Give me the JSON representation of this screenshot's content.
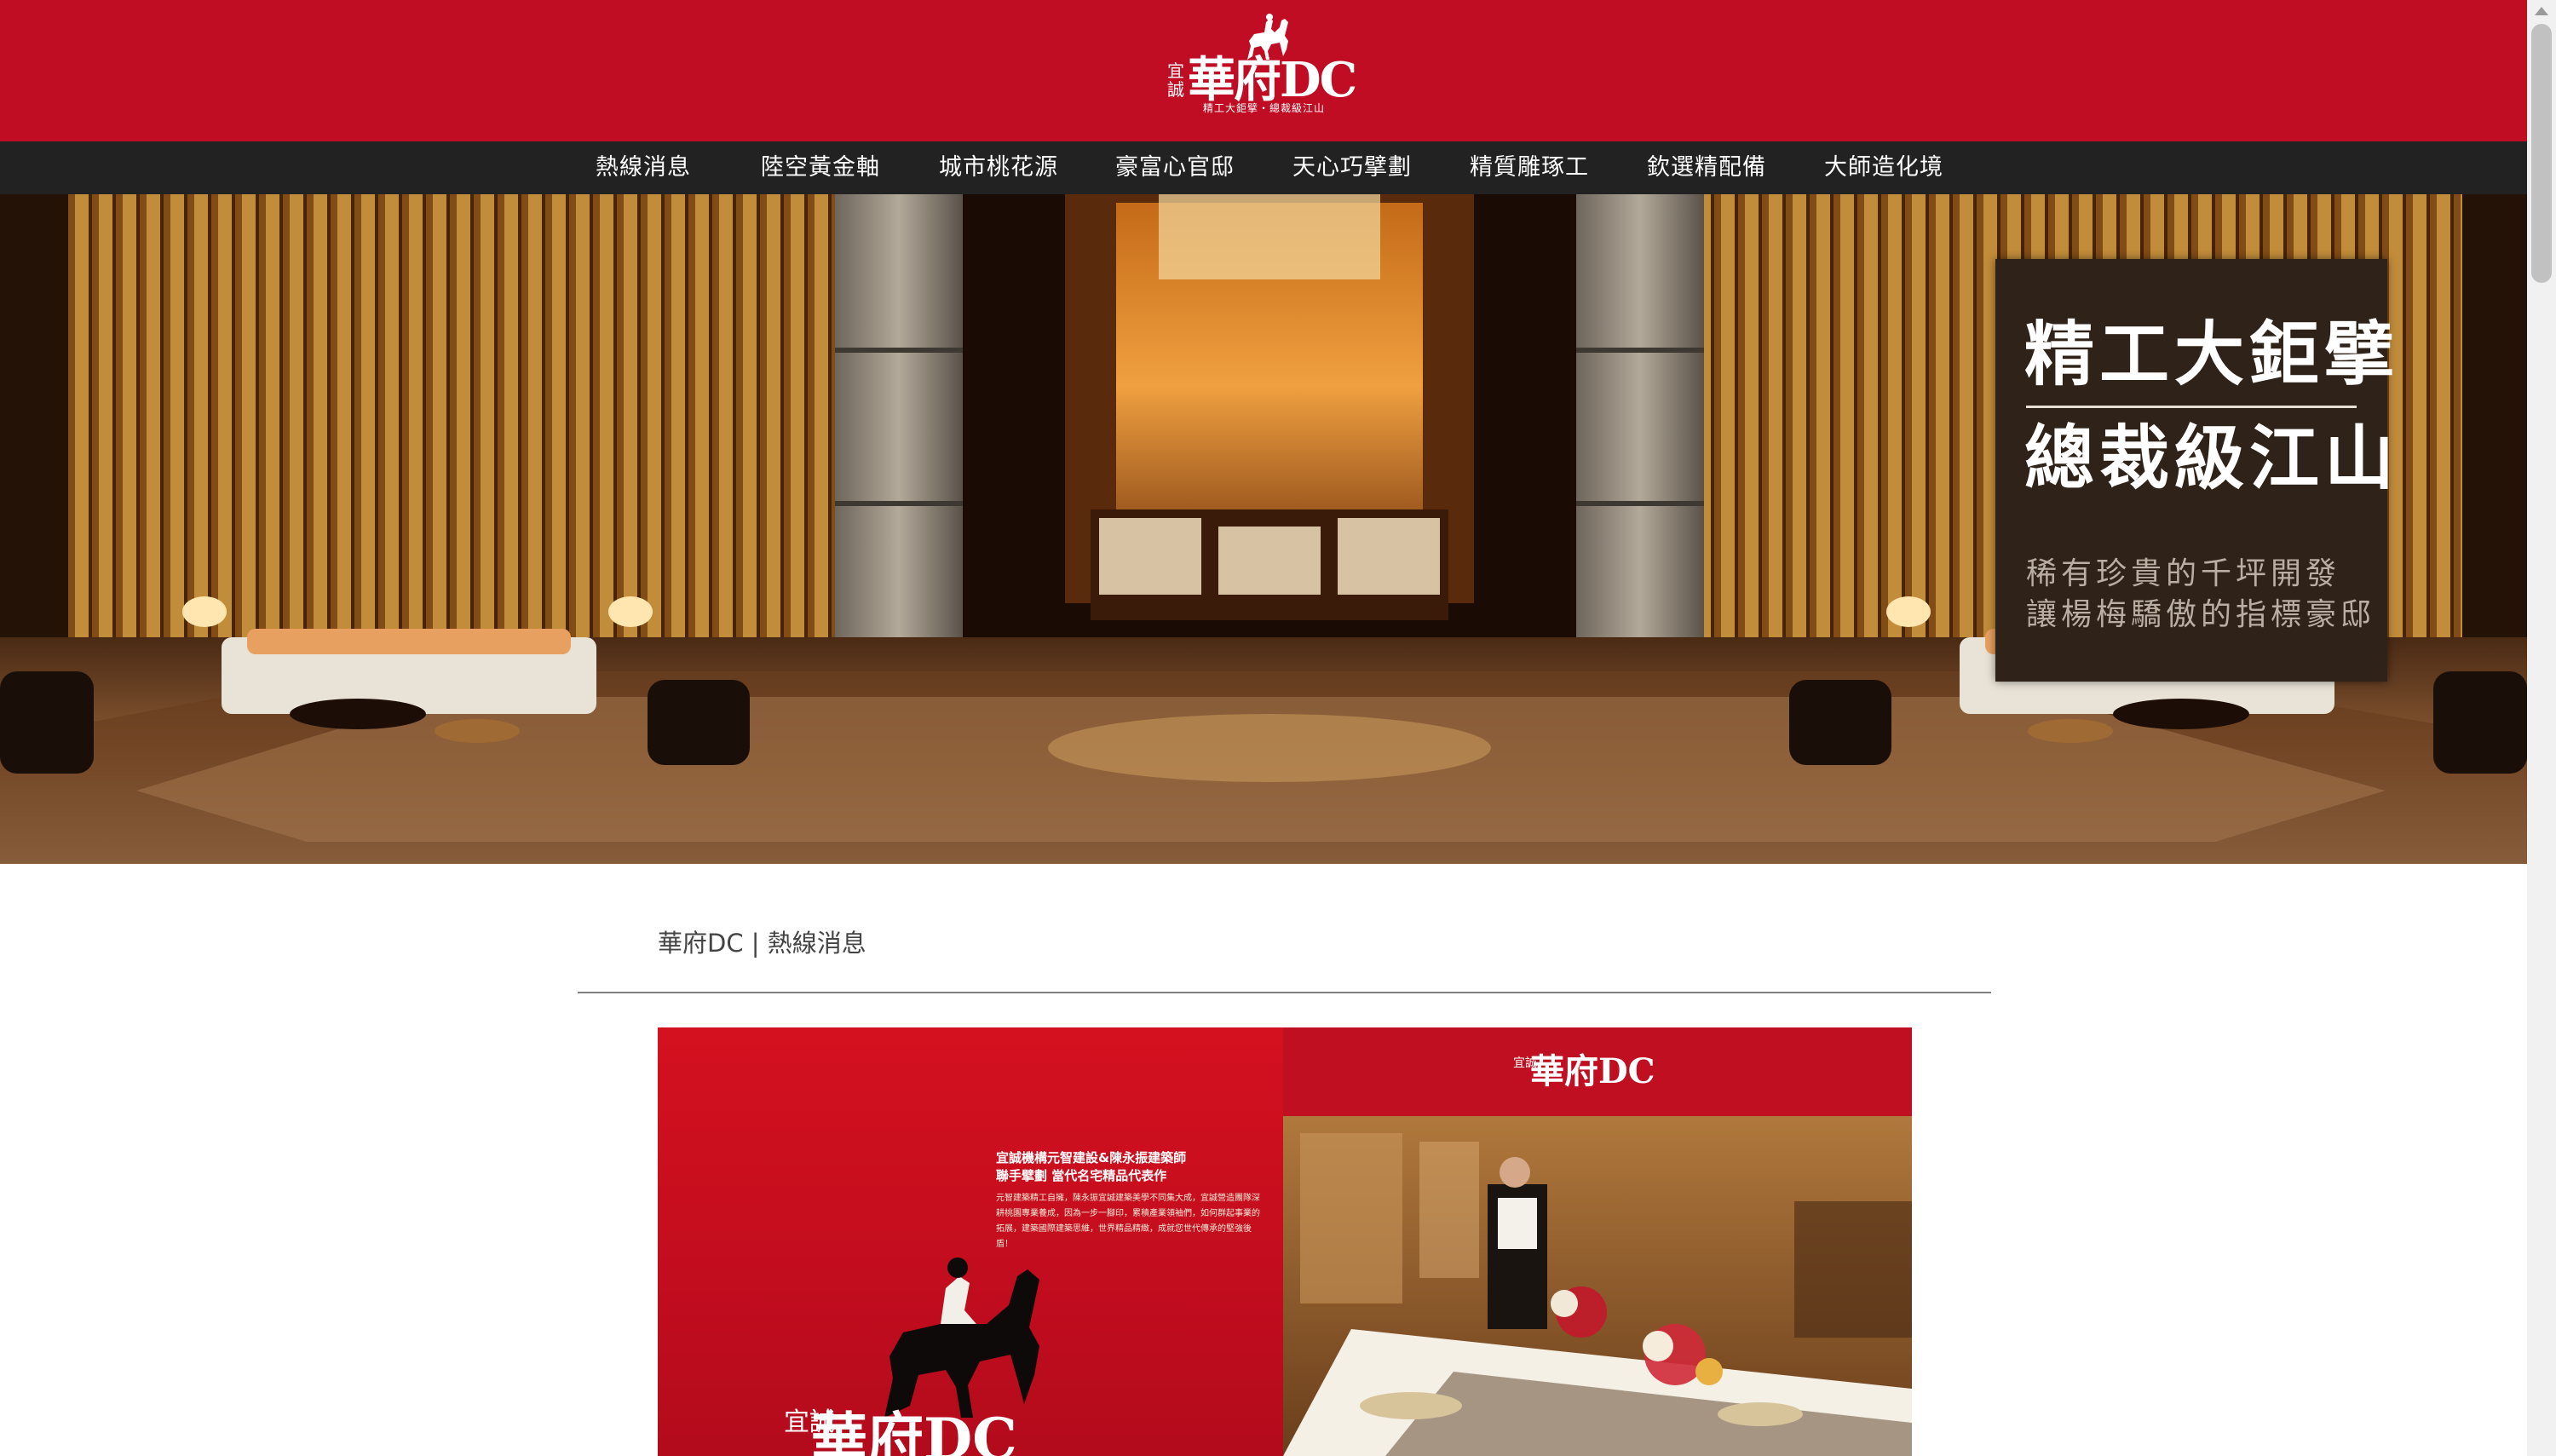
{
  "header": {
    "logo_vertical": "宜誠",
    "logo_main": "華府DC",
    "logo_tagline": "精工大鉅擘・總裁級江山",
    "bg_color": "#c00d24"
  },
  "nav": {
    "items": [
      {
        "label": "熱線消息"
      },
      {
        "label": "陸空黃金軸"
      },
      {
        "label": "城市桃花源"
      },
      {
        "label": "豪富心官邸"
      },
      {
        "label": "天心巧擘劃"
      },
      {
        "label": "精質雕琢工"
      },
      {
        "label": "欽選精配備"
      },
      {
        "label": "大師造化境"
      }
    ]
  },
  "hero": {
    "title_line1": "精工大鉅擘",
    "title_line2": "總裁級江山",
    "subtitle_line1": "稀有珍貴的千坪開發",
    "subtitle_line2": "讓楊梅驕傲的指標豪邸"
  },
  "content": {
    "breadcrumb": "華府DC | 熱線消息",
    "brochure": {
      "right_logo_vertical": "宜誠",
      "right_logo_main": "華府DC",
      "headline1": "宜誠機構元智建設&陳永振建築師",
      "headline2": "聯手擘劃 當代名宅精品代表作",
      "body": "元智建築精工自擁，陳永振宜誠建築美學不同集大成，宜誠營造團隊深耕桃園專業養成，因為一步一腳印，累積產業領袖們，如何群起事業的拓展，建築國際建築思維，世界精品精緻，成就您世代傳承的堅強後盾！",
      "left_logo_vertical": "宜誠",
      "left_logo_main": "華府DC"
    }
  }
}
